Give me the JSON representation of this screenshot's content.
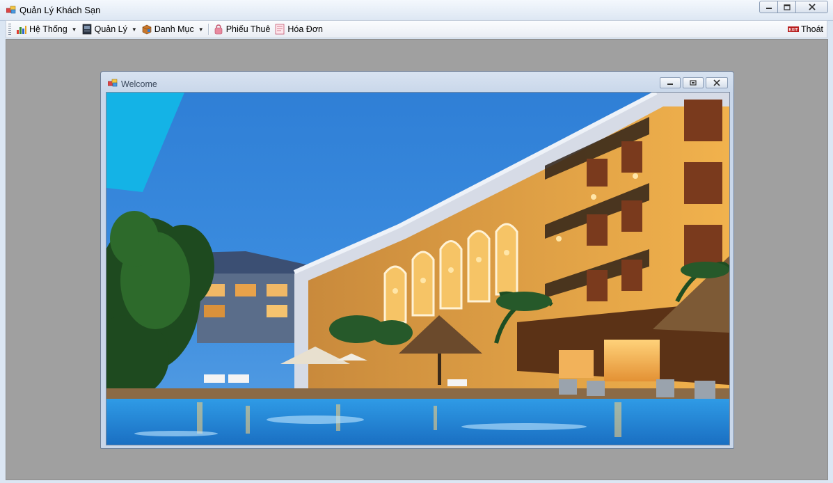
{
  "window": {
    "title": "Quản Lý Khách Sạn",
    "icon": "app-window-icon",
    "controls": [
      "minimize-icon",
      "maximize-icon",
      "close-icon"
    ]
  },
  "menu": {
    "items": [
      {
        "label": "Hệ Thống",
        "icon": "system-chart-icon",
        "dropdown": true
      },
      {
        "label": "Quản Lý",
        "icon": "manage-book-icon",
        "dropdown": true
      },
      {
        "label": "Danh Mục",
        "icon": "catalog-box-icon",
        "dropdown": true
      },
      {
        "label": "Phiếu Thuê",
        "icon": "rental-slip-icon",
        "dropdown": false
      },
      {
        "label": "Hóa Đơn",
        "icon": "invoice-icon",
        "dropdown": false
      }
    ],
    "exit": {
      "label": "Thoát",
      "icon": "exit-icon"
    }
  },
  "child_window": {
    "title": "Welcome",
    "icon": "child-window-icon",
    "image": "hotel-pool-night-photo"
  },
  "colors": {
    "mdi_background": "#a0a0a0",
    "titlebar": "#dde7f3",
    "sky": "#3a87d4"
  }
}
